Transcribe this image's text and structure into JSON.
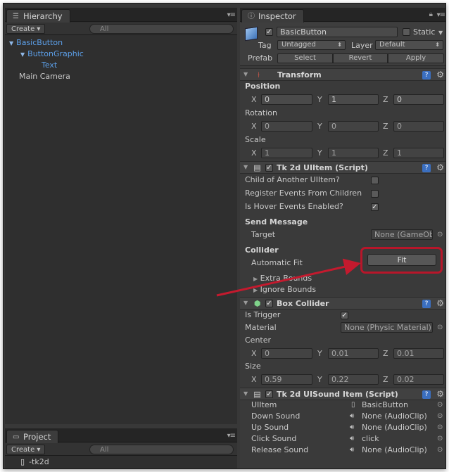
{
  "hierarchy": {
    "tab_label": "Hierarchy",
    "create_label": "Create",
    "search_placeholder": "All",
    "items": [
      {
        "label": "BasicButton"
      },
      {
        "label": "ButtonGraphic"
      },
      {
        "label": "Text"
      },
      {
        "label": "Main Camera"
      }
    ]
  },
  "project": {
    "tab_label": "Project",
    "create_label": "Create",
    "search_placeholder": "All",
    "items": [
      {
        "label": "-tk2d"
      }
    ]
  },
  "inspector": {
    "tab_label": "Inspector",
    "object_name": "BasicButton",
    "static_label": "Static",
    "tag_label": "Tag",
    "tag_value": "Untagged",
    "layer_label": "Layer",
    "layer_value": "Default",
    "prefab_label": "Prefab",
    "prefab_select": "Select",
    "prefab_revert": "Revert",
    "prefab_apply": "Apply",
    "transform": {
      "title": "Transform",
      "position_label": "Position",
      "rotation_label": "Rotation",
      "scale_label": "Scale",
      "position": {
        "x": "0",
        "y": "1",
        "z": "0"
      },
      "rotation": {
        "x": "0",
        "y": "0",
        "z": "0"
      },
      "scale": {
        "x": "1",
        "y": "1",
        "z": "1"
      }
    },
    "uiitem": {
      "title": "Tk 2d UIItem (Script)",
      "child_label": "Child of Another UIItem?",
      "register_label": "Register Events From Children",
      "hover_label": "Is Hover Events Enabled?",
      "send_message_label": "Send Message",
      "target_label": "Target",
      "target_value": "None (GameObj",
      "collider_label": "Collider",
      "automatic_fit_label": "Automatic Fit",
      "fit_button": "Fit",
      "extra_bounds_label": "Extra Bounds",
      "ignore_bounds_label": "Ignore Bounds"
    },
    "box_collider": {
      "title": "Box Collider",
      "trigger_label": "Is Trigger",
      "material_label": "Material",
      "material_value": "None (Physic Material)",
      "center_label": "Center",
      "size_label": "Size",
      "center": {
        "x": "0",
        "y": "0.01",
        "z": "0.01"
      },
      "size": {
        "x": "0.59",
        "y": "0.22",
        "z": "0.02"
      }
    },
    "uisound": {
      "title": "Tk 2d UISound Item (Script)",
      "uiitem_label": "UIItem",
      "uiitem_value": "BasicButton",
      "down_label": "Down Sound",
      "down_value": "None (AudioClip)",
      "up_label": "Up Sound",
      "up_value": "None (AudioClip)",
      "click_label": "Click Sound",
      "click_value": "click",
      "release_label": "Release Sound",
      "release_value": "None (AudioClip)"
    },
    "axis": {
      "x": "X",
      "y": "Y",
      "z": "Z"
    }
  },
  "colors": {
    "highlight": "#b8162a",
    "selection_blue": "#5c9fe8"
  }
}
